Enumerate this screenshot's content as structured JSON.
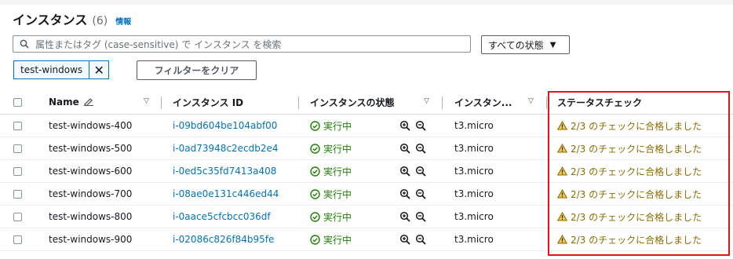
{
  "header": {
    "title": "インスタンス",
    "count": "(6)",
    "info_link": "情報"
  },
  "search": {
    "placeholder": "属性またはタグ (case-sensitive) で インスタンス を検索"
  },
  "state_filter": {
    "selected": "すべての状態"
  },
  "filter_token": {
    "label": "test-windows"
  },
  "clear_filters_label": "フィルターをクリア",
  "table": {
    "columns": {
      "name": "Name",
      "instance_id": "インスタンス ID",
      "state": "インスタンスの状態",
      "type": "インスタン...",
      "status_check": "ステータスチェック"
    },
    "rows": [
      {
        "name": "test-windows-400",
        "instance_id": "i-09bd604be104abf00",
        "state": "実行中",
        "type": "t3.micro",
        "status_check": "2/3 のチェックに合格しました"
      },
      {
        "name": "test-windows-500",
        "instance_id": "i-0ad73948c2ecdb2e4",
        "state": "実行中",
        "type": "t3.micro",
        "status_check": "2/3 のチェックに合格しました"
      },
      {
        "name": "test-windows-600",
        "instance_id": "i-0ed5c35fd7413a408",
        "state": "実行中",
        "type": "t3.micro",
        "status_check": "2/3 のチェックに合格しました"
      },
      {
        "name": "test-windows-700",
        "instance_id": "i-08ae0e131c446ed44",
        "state": "実行中",
        "type": "t3.micro",
        "status_check": "2/3 のチェックに合格しました"
      },
      {
        "name": "test-windows-800",
        "instance_id": "i-0aace5cfcbcc036df",
        "state": "実行中",
        "type": "t3.micro",
        "status_check": "2/3 のチェックに合格しました"
      },
      {
        "name": "test-windows-900",
        "instance_id": "i-02086c826f84b95fe",
        "state": "実行中",
        "type": "t3.micro",
        "status_check": "2/3 のチェックに合格しました"
      }
    ]
  },
  "colors": {
    "link": "#0073bb",
    "running": "#1d8102",
    "warning": "#8a6d00",
    "highlight": "#e0141a"
  }
}
